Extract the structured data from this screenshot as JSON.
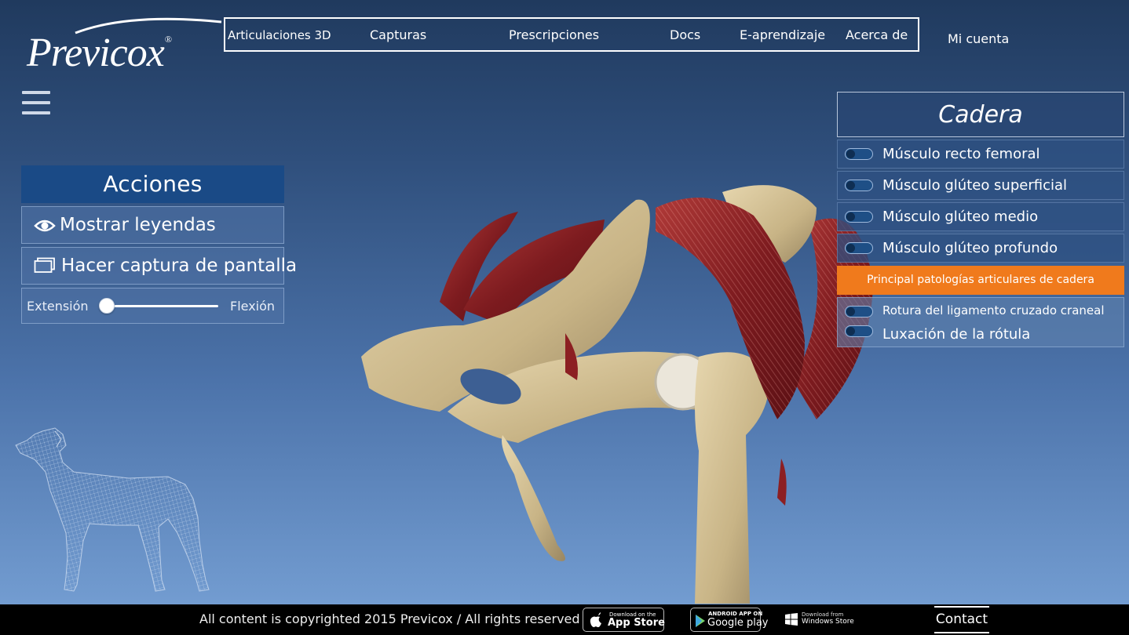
{
  "brand": {
    "logo_text": "Previcox",
    "reg_mark": "®"
  },
  "nav": {
    "items": [
      {
        "label": "Articulaciones 3D"
      },
      {
        "label": "Capturas"
      },
      {
        "label": "Prescripciones"
      },
      {
        "label": "Docs"
      },
      {
        "label": "E-aprendizaje"
      },
      {
        "label": "Acerca de"
      }
    ],
    "account_label": "Mi cuenta"
  },
  "actions": {
    "title": "Acciones",
    "show_legends_label": "Mostrar leyendas",
    "screenshot_label": "Hacer captura de pantalla",
    "slider": {
      "left_label": "Extensión",
      "right_label": "Flexión",
      "value": 0.0
    }
  },
  "joint_panel": {
    "title": "Cadera",
    "layers": [
      {
        "label": "Músculo recto femoral",
        "on": false
      },
      {
        "label": "Músculo glúteo superficial",
        "on": false
      },
      {
        "label": "Músculo glúteo medio",
        "on": false
      },
      {
        "label": "Músculo glúteo profundo",
        "on": false
      }
    ],
    "pathologies_button": "Principal patologías articulares de cadera",
    "pathologies": [
      {
        "label": "Rotura del ligamento cruzado craneal",
        "on": false
      },
      {
        "label": "Luxación de la rótula",
        "on": false
      }
    ]
  },
  "footer": {
    "copyright": "All content is copyrighted 2015 Previcox / All rights reserved",
    "app_store": {
      "small": "Download on the",
      "big": "App Store"
    },
    "google_play": {
      "small": "ANDROID APP ON",
      "big": "Google play"
    },
    "windows_store": {
      "small": "Download from",
      "big": "Windows Store"
    },
    "contact_label": "Contact"
  },
  "colors": {
    "actions_title_bg": "#1a4a86",
    "pathology_accent": "#f07a1c",
    "bone": "#cdbb93",
    "muscle": "#8c1f22"
  }
}
